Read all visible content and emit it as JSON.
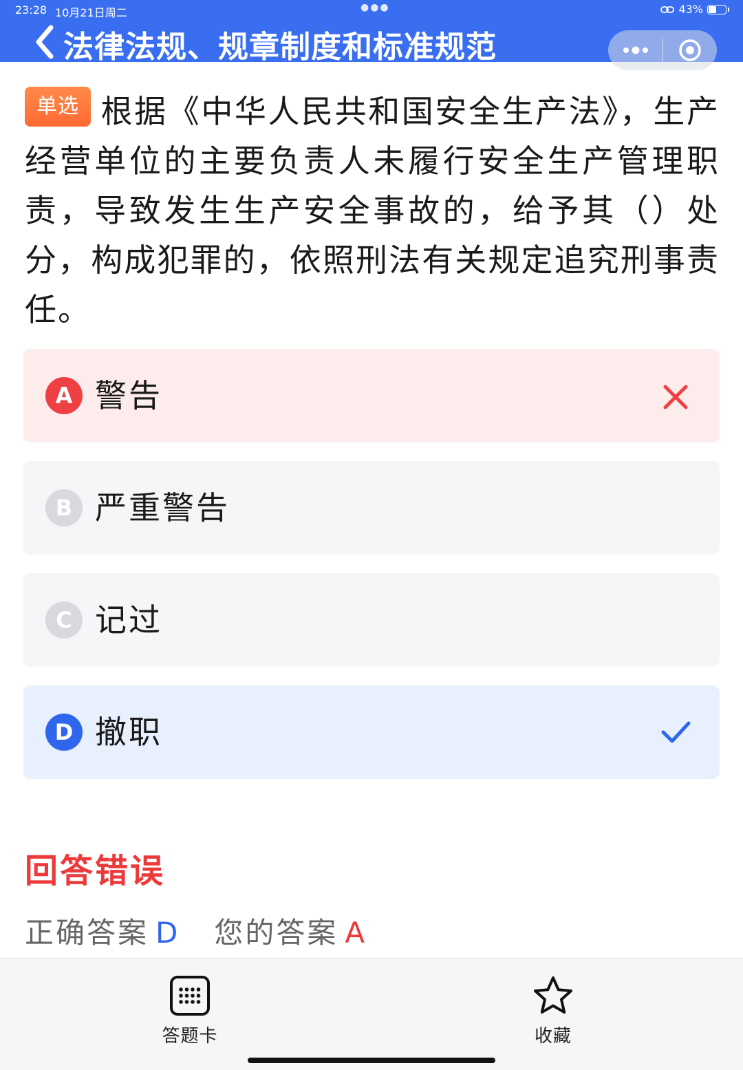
{
  "status_bar": {
    "time": "23:28",
    "date": "10月21日周二",
    "battery": "43%",
    "battery_level": 0.43
  },
  "nav": {
    "title": "法律法规、规章制度和标准规范"
  },
  "question": {
    "type_tag": "单选",
    "text": "根据《中华人民共和国安全生产法》，生产经营单位的主要负责人未履行安全生产管理职责，导致发生生产安全事故的，给予其（）处分，构成犯罪的，依照刑法有关规定追究刑事责任。"
  },
  "options": [
    {
      "letter": "A",
      "text": "警告",
      "state": "wrong"
    },
    {
      "letter": "B",
      "text": "严重警告",
      "state": "normal"
    },
    {
      "letter": "C",
      "text": "记过",
      "state": "normal"
    },
    {
      "letter": "D",
      "text": "撤职",
      "state": "correct"
    }
  ],
  "result": {
    "title": "回答错误",
    "correct_label": "正确答案",
    "correct_value": "D",
    "user_label": "您的答案",
    "user_value": "A"
  },
  "bottom_bar": {
    "answer_card_label": "答题卡",
    "answer_card_icon": "grid-icon",
    "favorite_label": "收藏",
    "favorite_icon": "star-icon"
  },
  "colors": {
    "header": "#3a6ef0",
    "wrong": "#ef4043",
    "correct": "#2f66ee",
    "tag": "#ff6a33"
  }
}
